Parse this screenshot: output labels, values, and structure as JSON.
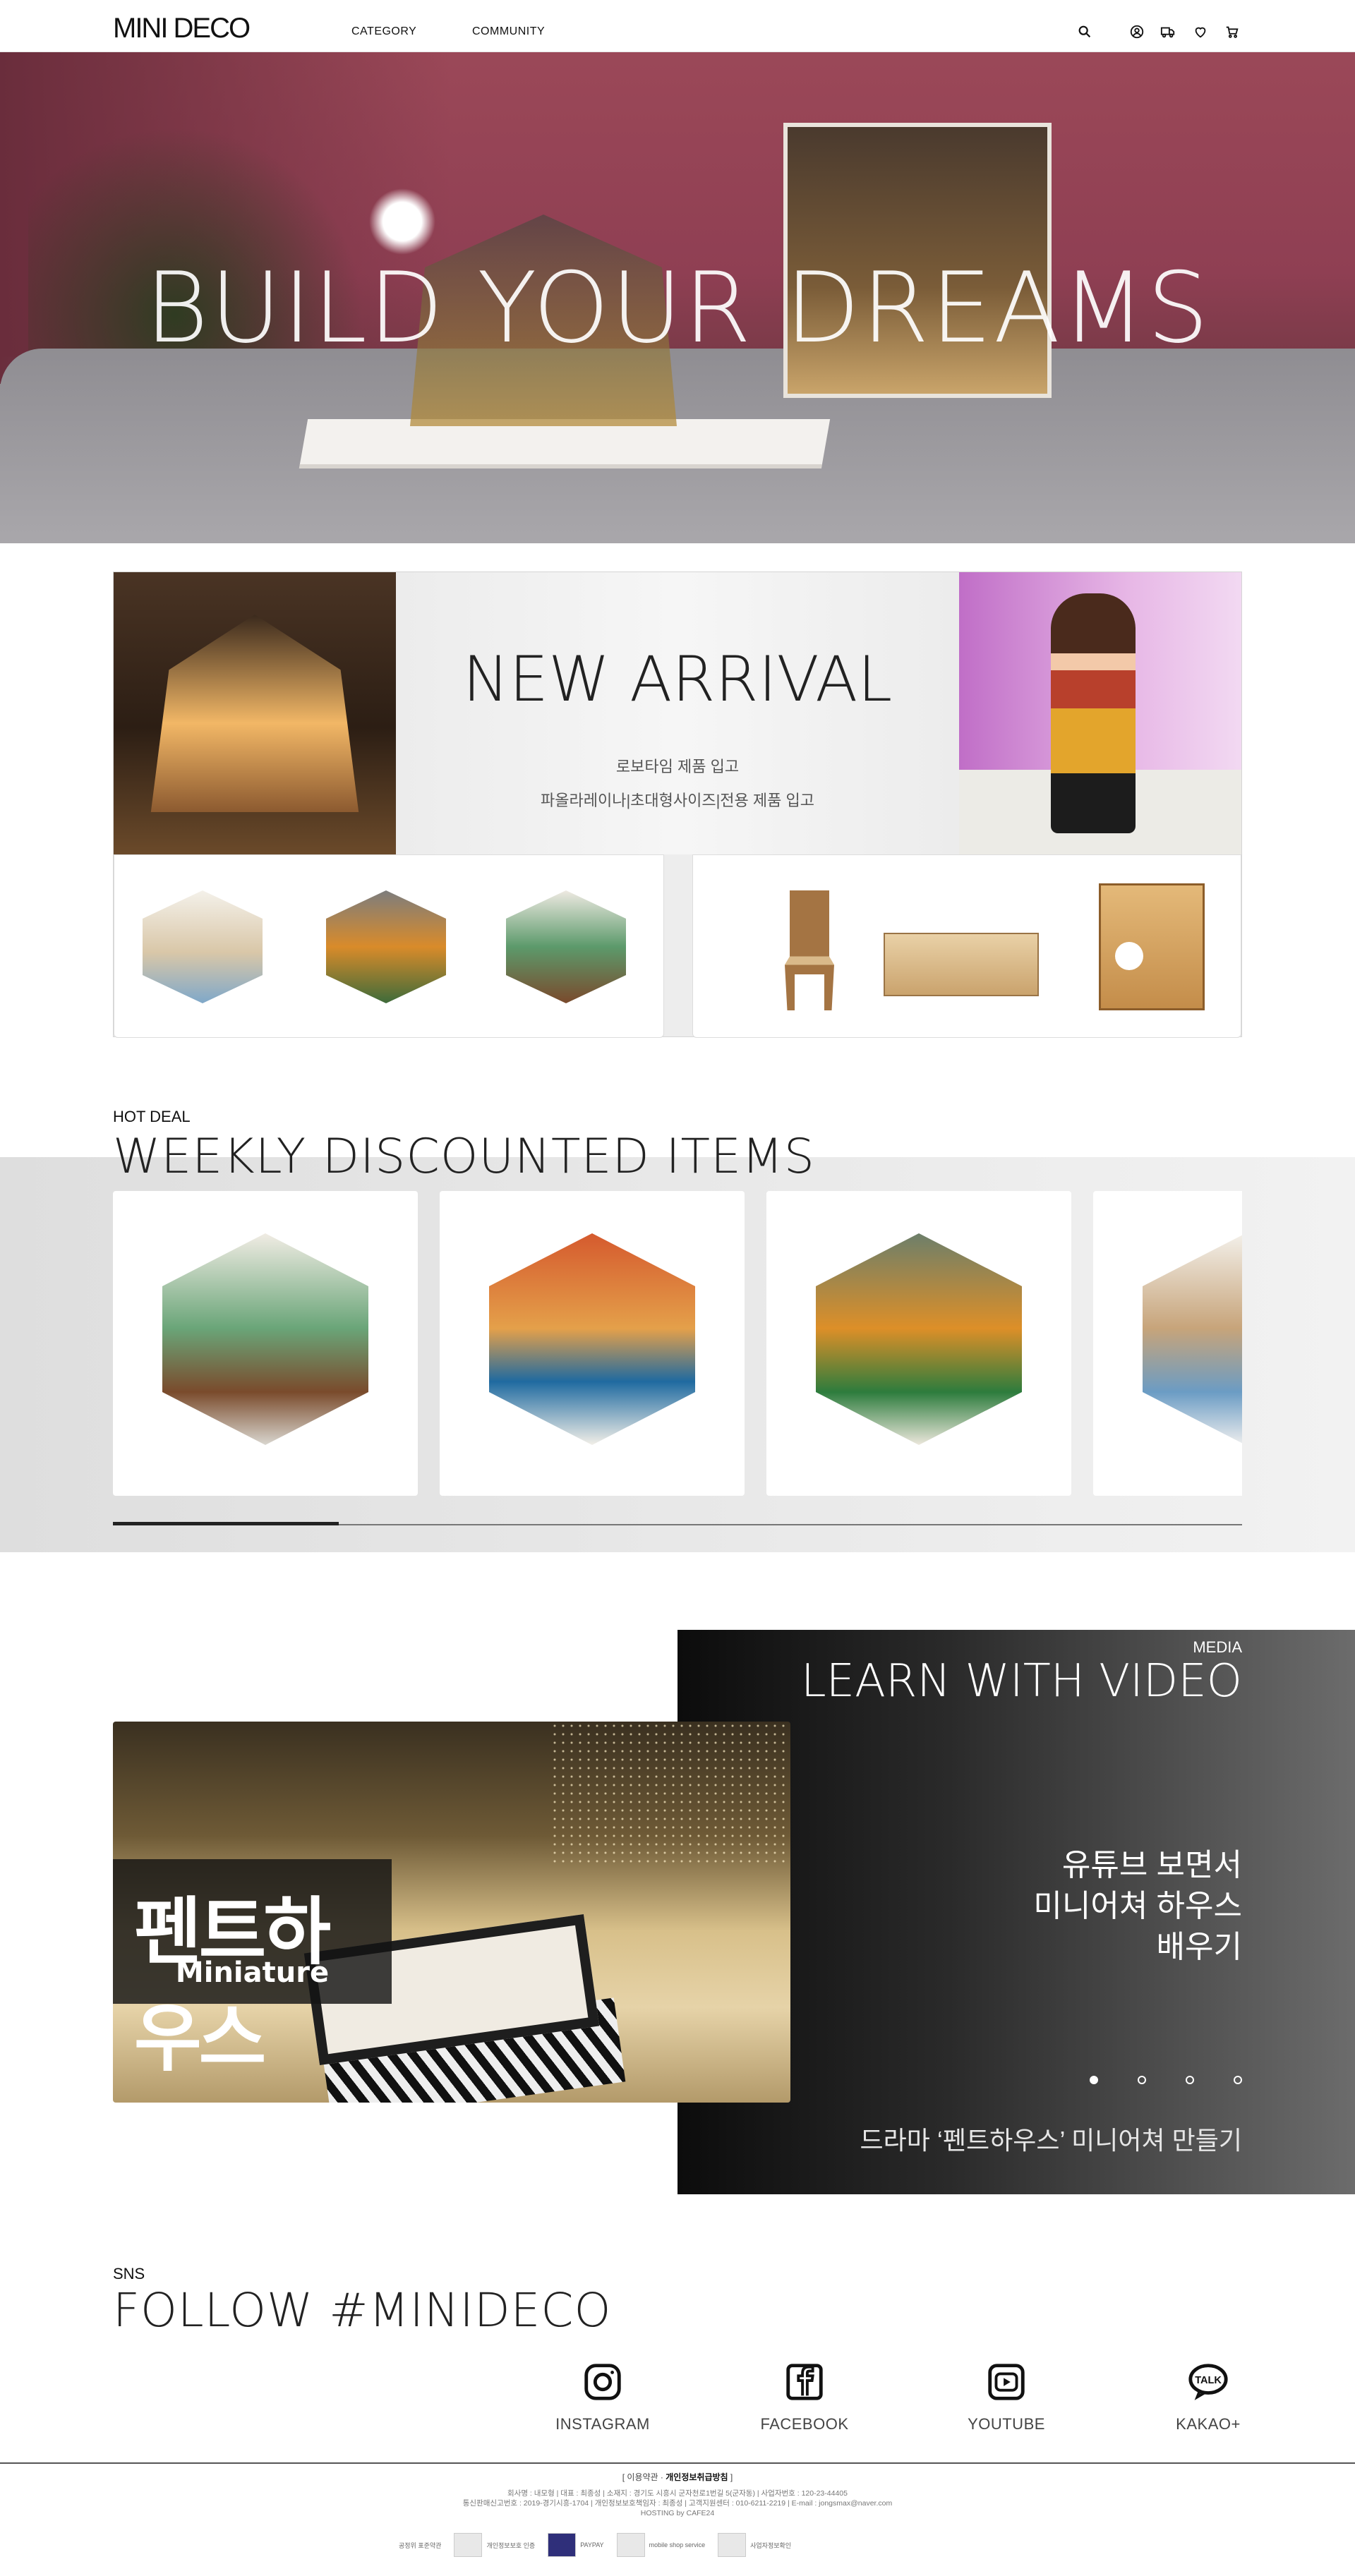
{
  "header": {
    "logo": "MINI DECO",
    "nav": [
      "CATEGORY",
      "COMMUNITY"
    ],
    "icons": [
      "search-icon",
      "user-icon",
      "delivery-truck-icon",
      "heart-icon",
      "cart-icon"
    ]
  },
  "hero": {
    "title": "BUILD YOUR DREAMS"
  },
  "new_arrival": {
    "title": "NEW ARRIVAL",
    "line1": "로보타임 제품 입고",
    "line2": "파올라레이나|초대형사이즈|전용 제품 입고"
  },
  "weekly": {
    "label": "HOT DEAL",
    "title": "WEEKLY DISCOUNTED ITEMS",
    "progress": 0.2
  },
  "media": {
    "label": "MEDIA",
    "title": "LEARN WITH VIDEO",
    "video_overlay_title": "펜트하우스",
    "video_overlay_sub": "Miniature",
    "caption_lines": [
      "유튜브 보면서",
      "미니어쳐 하우스",
      "배우기"
    ],
    "description": "드라마 ‘펜트하우스’ 미니어쳐 만들기",
    "slides": 4,
    "active_slide": 0
  },
  "sns": {
    "label": "SNS",
    "title": "FOLLOW #MINIDECO",
    "items": [
      {
        "icon": "instagram-icon",
        "label": "INSTAGRAM"
      },
      {
        "icon": "facebook-icon",
        "label": "FACEBOOK"
      },
      {
        "icon": "youtube-icon",
        "label": "YOUTUBE"
      },
      {
        "icon": "kakao-talk-icon",
        "label": "KAKAO+"
      }
    ]
  },
  "footer": {
    "terms": "이용약관",
    "privacy": "개인정보취급방침",
    "line1": "회사명 : 내모형 | 대표 : 최종성 | 소재지 : 경기도 시흥시 군자천로1번길 5(군자동) | 사업자번호 : 120-23-44405",
    "line2": "통신판매신고번호 : 2019-경기시흥-1704 | 개인정보보호책임자 : 최종성 | 고객지원센터 : 010-6211-2219 | E-mail : jongsmax@naver.com",
    "line3": "HOSTING by CAFE24",
    "badges": [
      "공정위 표준약관",
      "개인정보보호 인증",
      "PAYPAY",
      "mobile shop service",
      "사업자정보확인"
    ]
  }
}
